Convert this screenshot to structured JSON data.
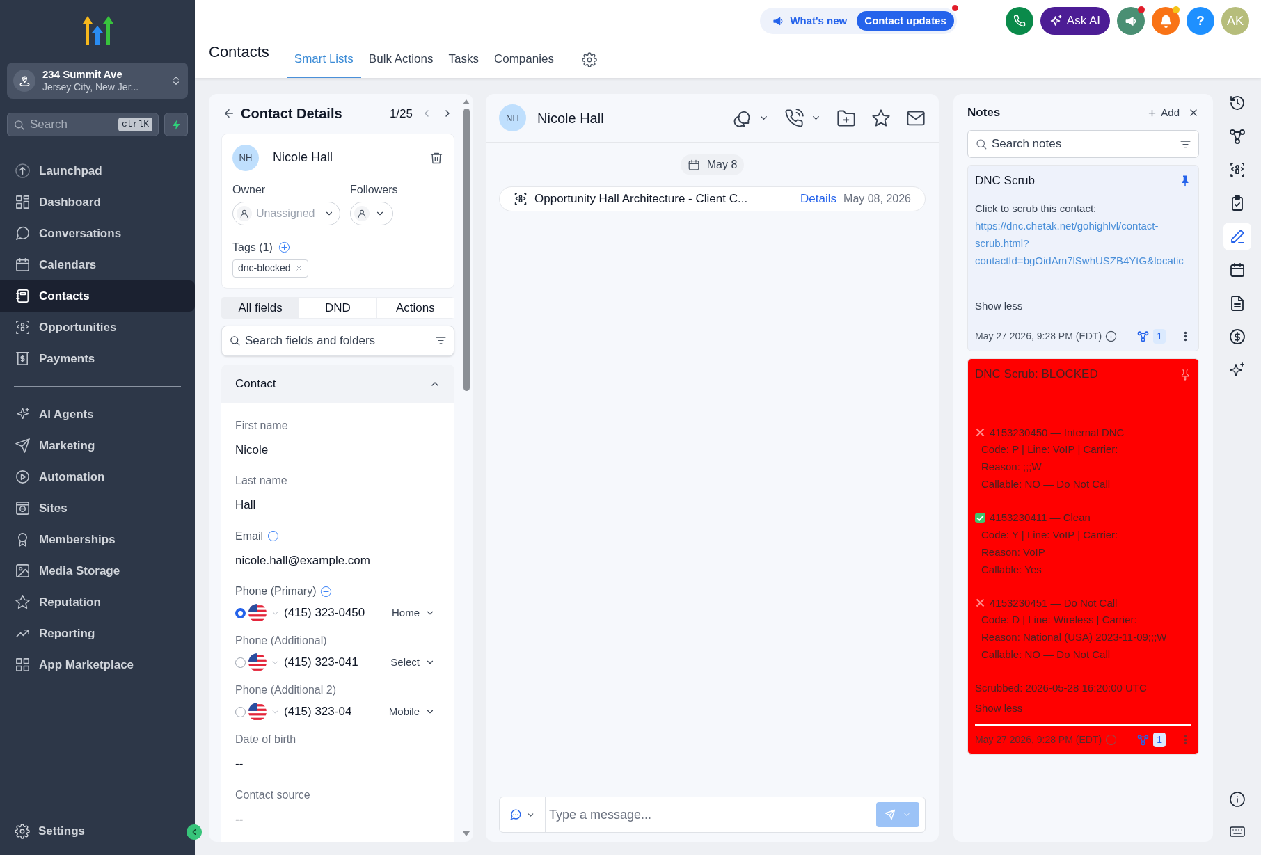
{
  "sidebar": {
    "location": {
      "name": "234 Summit Ave",
      "address": "Jersey City, New Jer..."
    },
    "search": {
      "placeholder": "Search",
      "shortcut": "ctrlK"
    },
    "nav": [
      {
        "label": "Launchpad",
        "selected": false
      },
      {
        "label": "Dashboard",
        "selected": false
      },
      {
        "label": "Conversations",
        "selected": false
      },
      {
        "label": "Calendars",
        "selected": false
      },
      {
        "label": "Contacts",
        "selected": true
      },
      {
        "label": "Opportunities",
        "selected": false
      },
      {
        "label": "Payments",
        "selected": false
      }
    ],
    "nav_more": [
      {
        "label": "AI Agents",
        "selected": false
      },
      {
        "label": "Marketing",
        "selected": false
      },
      {
        "label": "Automation",
        "selected": false
      },
      {
        "label": "Sites",
        "selected": false
      },
      {
        "label": "Memberships",
        "selected": false
      },
      {
        "label": "Media Storage",
        "selected": false
      },
      {
        "label": "Reputation",
        "selected": false
      },
      {
        "label": "Reporting",
        "selected": false
      },
      {
        "label": "App Marketplace",
        "selected": false
      }
    ],
    "settings": "Settings"
  },
  "topbar": {
    "whats_new": "What's new",
    "updates": {
      "label": "Contact updates",
      "unread": true
    },
    "ask_ai": "Ask AI",
    "announcements": {
      "unread": true
    },
    "notifications": {
      "unread": true
    },
    "help": "?",
    "avatar": "AK"
  },
  "page": {
    "title": "Contacts",
    "tabs": [
      {
        "label": "Smart Lists",
        "selected": true
      },
      {
        "label": "Bulk Actions",
        "selected": false
      },
      {
        "label": "Tasks",
        "selected": false
      },
      {
        "label": "Companies",
        "selected": false
      }
    ]
  },
  "contact": {
    "title": "Contact Details",
    "pager": "1/25",
    "avatar": "NH",
    "name": "Nicole Hall",
    "owner_label": "Owner",
    "owner": "Unassigned",
    "followers_label": "Followers",
    "tags_label": "Tags (1)",
    "tags": [
      "dnc-blocked"
    ],
    "tabs": [
      {
        "label": "All fields",
        "selected": true
      },
      {
        "label": "DND",
        "selected": false
      },
      {
        "label": "Actions",
        "selected": false
      }
    ],
    "search": {
      "placeholder": "Search fields and folders"
    },
    "section": {
      "title": "Contact",
      "expanded": true
    },
    "fields": [
      {
        "kind": "text",
        "label": "First name",
        "value": "Nicole",
        "addable": false
      },
      {
        "kind": "text",
        "label": "Last name",
        "value": "Hall",
        "addable": false
      },
      {
        "kind": "text",
        "label": "Email",
        "value": "nicole.hall@example.com",
        "addable": true
      },
      {
        "kind": "phone",
        "label": "Phone (Primary)",
        "value": "(415) 323-0450",
        "type": "Home",
        "selected": true,
        "addable": true
      },
      {
        "kind": "phone",
        "label": "Phone (Additional)",
        "value": "(415) 323-041",
        "type": "Select",
        "selected": false,
        "addable": false
      },
      {
        "kind": "phone",
        "label": "Phone (Additional 2)",
        "value": "(415) 323-04",
        "type": "Mobile",
        "selected": false,
        "addable": false
      },
      {
        "kind": "text",
        "label": "Date of birth",
        "value": "--",
        "addable": false
      },
      {
        "kind": "text",
        "label": "Contact source",
        "value": "--",
        "addable": false
      }
    ]
  },
  "conversation": {
    "avatar": "NH",
    "name": "Nicole Hall",
    "date_chip": "May 8",
    "activity": {
      "title": "Opportunity Hall Architecture - Client C...",
      "link": "Details",
      "date": "May 08, 2026"
    },
    "composer": {
      "placeholder": "Type a message..."
    }
  },
  "notes": {
    "title": "Notes",
    "add": "Add",
    "search": {
      "placeholder": "Search notes"
    },
    "items": [
      {
        "kind": "link",
        "title": "DNC Scrub",
        "pinned": true,
        "color": "#eef2fb",
        "text": "Click to scrub this contact:",
        "link": "https://dnc.chetak.net/gohighlvl/contact-scrub.html?contactId=bgOidAm7lSwhUSZB4YtG&locatic",
        "toggle": "Show less",
        "timestamp": "May 27 2026, 9:28 PM (EDT)",
        "count": "1"
      },
      {
        "kind": "scrub",
        "title": "DNC Scrub: BLOCKED",
        "pinned": false,
        "color": "#ff0000",
        "results": [
          {
            "callable": false,
            "heading": "4153230450 — Internal DNC",
            "details": [
              "Code: P | Line: VoIP | Carrier:",
              "Reason: ;;;W",
              "Callable: NO — Do Not Call"
            ]
          },
          {
            "callable": true,
            "heading": "4153230411 — Clean",
            "details": [
              "Code: Y | Line: VoIP | Carrier:",
              "Reason: VoIP",
              "Callable: Yes"
            ]
          },
          {
            "callable": false,
            "heading": "4153230451 — Do Not Call",
            "details": [
              "Code: D | Line: Wireless | Carrier:",
              "Reason: National (USA) 2023-11-09;;;W",
              "Callable: NO — Do Not Call"
            ]
          }
        ],
        "scrubbed": "Scrubbed: 2026-05-28 16:20:00 UTC",
        "toggle": "Show less",
        "timestamp": "May 27 2026, 9:28 PM (EDT)",
        "count": "1"
      }
    ]
  },
  "rail": [
    {
      "selected": false
    },
    {
      "selected": false
    },
    {
      "selected": false
    },
    {
      "selected": false
    },
    {
      "selected": true
    },
    {
      "selected": false
    },
    {
      "selected": false
    },
    {
      "selected": false
    },
    {
      "selected": false
    }
  ]
}
